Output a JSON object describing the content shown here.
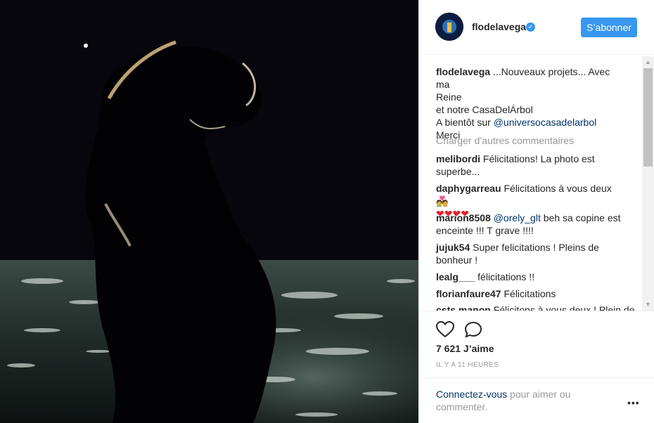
{
  "post": {
    "username": "flodelavega",
    "follow_label": "S’abonner",
    "verified_icon": "verified-badge-icon",
    "caption": {
      "username": "flodelavega",
      "line1": "...Nouveaux projets... Avec ma",
      "line2": "Reine",
      "line3": "et notre CasaDelÁrbol",
      "line4_prefix": "A bientôt sur ",
      "line4_mention": "@universocasadelarbol",
      "line5": "Merci"
    },
    "load_more": "Charger d’autres commentaires",
    "comments": [
      {
        "user": "melibordi",
        "text": "Félicitations! La photo est",
        "text2": "superbe..."
      },
      {
        "user": "daphygarreau",
        "text": "Félicitations à vous deux 💑",
        "text2": "❤❤❤❤"
      },
      {
        "user": "marion8508",
        "mention": "@orely_glt",
        "text": " beh sa copine est",
        "text2": "enceinte !!! T grave !!!!"
      },
      {
        "user": "jujuk54",
        "text": "Super felicitations ! Pleins de",
        "text2": "bonheur !"
      },
      {
        "user": "lealg___",
        "text": "félicitations !!"
      },
      {
        "user": "florianfaure47",
        "text": "Félicitations"
      },
      {
        "user": "csts.manon",
        "text": "Félicitons à vous deux ! Plein de"
      }
    ],
    "likes": "7 621 J’aime",
    "time": "IL Y A 11 HEURES",
    "login_link": "Connectez-vous",
    "login_rest": " pour aimer ou",
    "login_rest2": "commenter.",
    "more_label": "•••",
    "icons": {
      "like": "heart-icon",
      "comment": "comment-icon"
    }
  }
}
